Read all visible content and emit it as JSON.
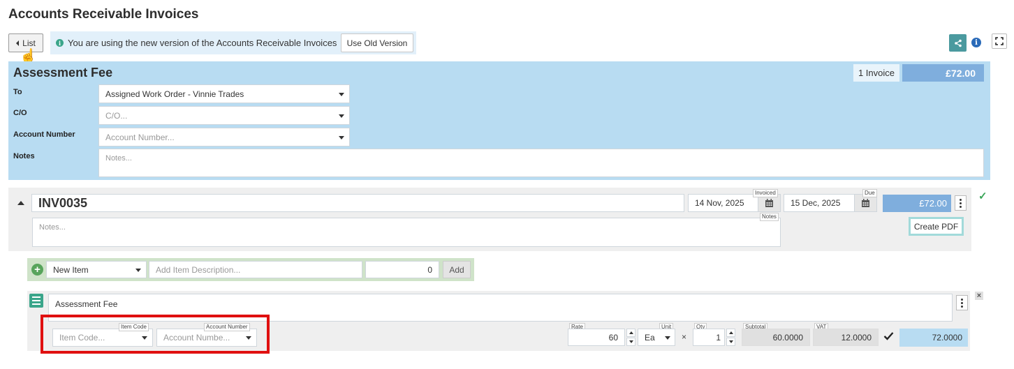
{
  "page": {
    "title": "Accounts Receivable Invoices"
  },
  "toolbar": {
    "list_label": "List",
    "notice_text": "You are using the new version of the Accounts Receivable Invoices",
    "old_version_label": "Use Old Version",
    "icons": [
      "share-icon",
      "info-icon",
      "expand-icon"
    ]
  },
  "header": {
    "title": "Assessment Fee",
    "invoice_count": "1 Invoice",
    "total": "£72.00",
    "to_label": "To",
    "to_value": "Assigned Work Order - Vinnie Trades",
    "co_label": "C/O",
    "co_placeholder": "C/O...",
    "account_label": "Account Number",
    "account_placeholder": "Account Number...",
    "notes_label": "Notes",
    "notes_placeholder": "Notes..."
  },
  "invoice": {
    "number": "INV0035",
    "invoiced_date": "14 Nov, 2025",
    "invoiced_label": "Invoiced",
    "due_date": "15 Dec, 2025",
    "due_label": "Due",
    "total": "£72.00",
    "notes_placeholder": "Notes...",
    "notes_label": "Notes",
    "create_pdf_label": "Create PDF"
  },
  "add_item": {
    "type_value": "New Item",
    "description_placeholder": "Add Item Description...",
    "amount_value": "0",
    "add_label": "Add"
  },
  "line_item": {
    "description": "Assessment Fee",
    "item_code_label": "Item Code",
    "item_code_placeholder": "Item Code...",
    "account_number_label": "Account Number",
    "account_number_placeholder": "Account Numbe...",
    "rate_label": "Rate",
    "rate_value": "60",
    "unit_label": "Unit",
    "unit_value": "Ea",
    "times_sign": "×",
    "qty_label": "Qty",
    "qty_value": "1",
    "subtotal_label": "Subtotal",
    "subtotal_value": "60.0000",
    "vat_label": "VAT",
    "vat_value": "12.0000",
    "vat_checked": true,
    "total_value": "72.0000"
  },
  "colors": {
    "header_bg": "#b8dcf2",
    "total_bg": "#7faedd",
    "accent_teal": "#3aa58a",
    "highlight_red": "#e01010"
  }
}
